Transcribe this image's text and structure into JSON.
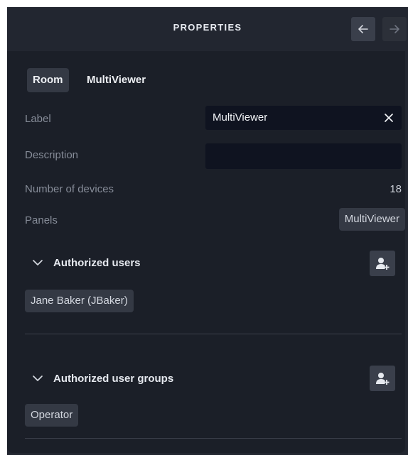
{
  "header": {
    "title": "PROPERTIES",
    "back_icon": "arrow-left-icon",
    "forward_icon": "arrow-right-icon"
  },
  "object": {
    "type": "Room",
    "name": "MultiViewer"
  },
  "properties": {
    "label": {
      "name": "Label",
      "value": "MultiViewer"
    },
    "description": {
      "name": "Description",
      "value": ""
    },
    "device_count": {
      "name": "Number of devices",
      "value": "18"
    },
    "panels": {
      "name": "Panels",
      "value": "MultiViewer"
    }
  },
  "authorized_users": {
    "title": "Authorized users",
    "items": [
      "Jane Baker (JBaker)"
    ],
    "add_icon": "add-user-icon"
  },
  "authorized_groups": {
    "title": "Authorized user groups",
    "items": [
      "Operator"
    ],
    "add_icon": "add-user-icon"
  },
  "colors": {
    "background": "#222630",
    "panel": "#1b1f28",
    "chip": "#343944",
    "input": "#0f1320",
    "muted_text": "#868c98"
  }
}
